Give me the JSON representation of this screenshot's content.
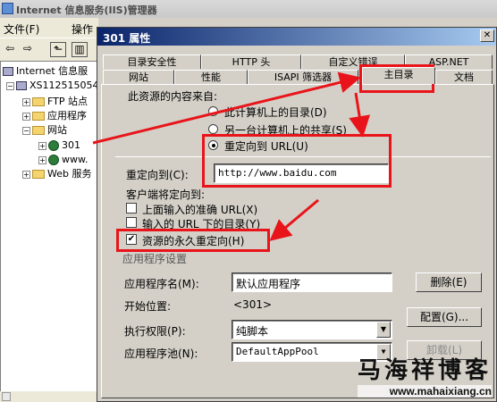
{
  "background_window": {
    "title": "Internet 信息服务(IIS)管理器",
    "menu": [
      "文件(F)",
      "操作"
    ],
    "tree": [
      {
        "label": "Internet 信息服",
        "icon": "computer-icon"
      },
      {
        "label": "XS112515054",
        "icon": "computer-icon"
      },
      {
        "label": "FTP 站点",
        "icon": "folder-icon"
      },
      {
        "label": "应用程序",
        "icon": "folder-icon"
      },
      {
        "label": "网站",
        "icon": "folder-icon"
      },
      {
        "label": "301",
        "icon": "globe-icon"
      },
      {
        "label": "www.",
        "icon": "globe-icon"
      },
      {
        "label": "Web 服务",
        "icon": "folder-icon"
      }
    ]
  },
  "dialog": {
    "title": "301 属性",
    "close": "✕",
    "tabs_row1": [
      "目录安全性",
      "HTTP 头",
      "自定义错误",
      "ASP.NET"
    ],
    "tabs_row2": [
      "网站",
      "性能",
      "ISAPI 筛选器",
      "主目录",
      "文档"
    ],
    "active_tab": "主目录",
    "content_source_label": "此资源的内容来自:",
    "source_options": [
      {
        "label": "此计算机上的目录(D)",
        "selected": false
      },
      {
        "label": "另一台计算机上的共享(S)",
        "selected": false
      },
      {
        "label": "重定向到 URL(U)",
        "selected": true
      }
    ],
    "redirect_label": "重定向到(C):",
    "redirect_value": "http://www.baidu.com",
    "client_redirect_label": "客户端将定向到:",
    "options": [
      {
        "label": "上面输入的准确 URL(X)",
        "checked": false
      },
      {
        "label": "输入的 URL 下的目录(Y)",
        "checked": false
      },
      {
        "label": "资源的永久重定向(H)",
        "checked": true
      }
    ],
    "app_settings_label": "应用程序设置",
    "app_name_label": "应用程序名(M):",
    "app_name_value": "默认应用程序",
    "start_label": "开始位置:",
    "start_value": "<301>",
    "exec_label": "执行权限(P):",
    "exec_value": "纯脚本",
    "pool_label": "应用程序池(N):",
    "pool_value": "DefaultAppPool",
    "buttons": {
      "delete": "删除(E)",
      "config": "配置(G)...",
      "unload": "卸载(L)"
    }
  },
  "watermark": {
    "title": "马海祥博客",
    "url": "www.mahaixiang.cn"
  },
  "colors": {
    "annotation_red": "#e8141a",
    "titlebar_start": "#0a246a",
    "titlebar_end": "#a6caf0"
  }
}
